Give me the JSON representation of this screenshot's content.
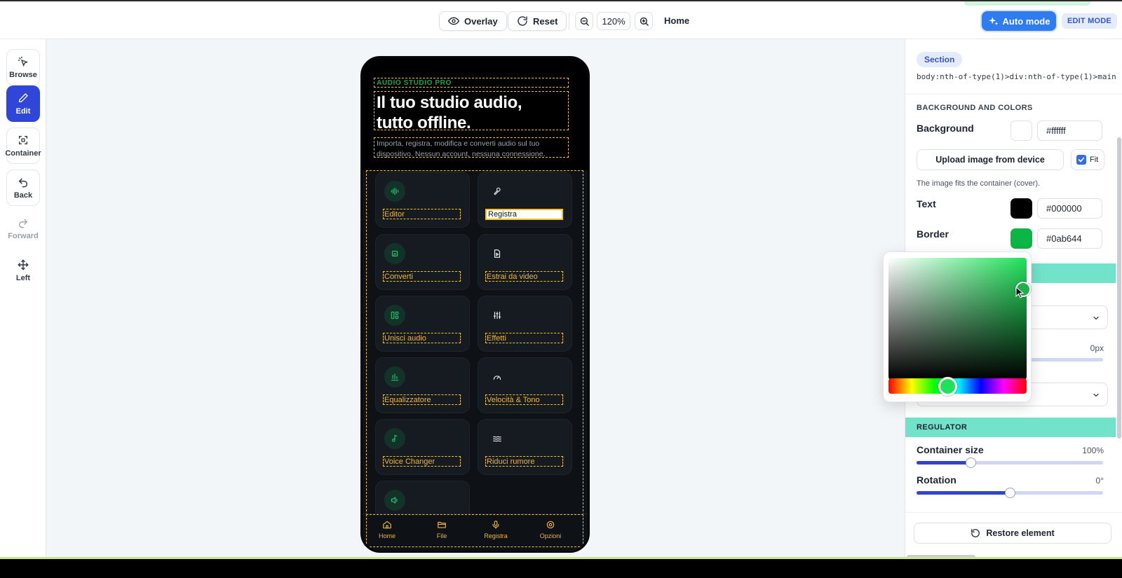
{
  "toolbar": {
    "overlay_label": "Overlay",
    "reset_label": "Reset",
    "zoom_level": "120%",
    "page_label": "Home",
    "auto_mode_label": "Auto mode",
    "edit_mode_badge": "EDIT MODE"
  },
  "sidebar": {
    "items": [
      {
        "label": "Browse",
        "icon": "pointer-sparkle-icon"
      },
      {
        "label": "Edit",
        "icon": "pencil-icon",
        "active": true
      },
      {
        "label": "Container",
        "icon": "container-icon"
      },
      {
        "label": "Back",
        "icon": "undo-icon"
      },
      {
        "label": "Forward",
        "icon": "redo-icon",
        "disabled": true
      },
      {
        "label": "Left",
        "icon": "move-icon"
      }
    ]
  },
  "phone": {
    "eyebrow": "AUDIO STUDIO PRO",
    "title_line1": "Il tuo studio audio,",
    "title_line2": "tutto offline.",
    "subtitle": "Importa, registra, modifica e converti audio sul tuo dispositivo. Nessun account, nessuna connessione.",
    "tiles": [
      {
        "label": "Editor",
        "icon": "waveform-icon",
        "style": "green"
      },
      {
        "label": "Registra",
        "icon": "microphone-icon",
        "style": "plain",
        "selected": true
      },
      {
        "label": "Converti",
        "icon": "convert-icon",
        "style": "green"
      },
      {
        "label": "Estrai da video",
        "icon": "file-video-icon",
        "style": "plain"
      },
      {
        "label": "Unisci audio",
        "icon": "merge-icon",
        "style": "green"
      },
      {
        "label": "Effetti",
        "icon": "sliders-icon",
        "style": "plain"
      },
      {
        "label": "Equalizzatore",
        "icon": "equalizer-icon",
        "style": "green"
      },
      {
        "label": "Velocità & Tono",
        "icon": "gauge-icon",
        "style": "plain"
      },
      {
        "label": "Voice Changer",
        "icon": "music-note-icon",
        "style": "green"
      },
      {
        "label": "Riduci rumore",
        "icon": "waves-icon",
        "style": "plain"
      },
      {
        "label": "",
        "icon": "speaker-icon",
        "style": "green"
      }
    ],
    "nav": [
      {
        "label": "Home",
        "icon": "home-icon"
      },
      {
        "label": "File",
        "icon": "folder-icon"
      },
      {
        "label": "Registra",
        "icon": "mic-icon"
      },
      {
        "label": "Opzioni",
        "icon": "settings-icon"
      }
    ]
  },
  "panel": {
    "section_chip": "Section",
    "selector": "body:nth-of-type(1)>div:nth-of-type(1)>main",
    "bg_heading": "BACKGROUND AND COLORS",
    "background_label": "Background",
    "background_hex": "#ffffff",
    "upload_label": "Upload image from device",
    "fit_label": "Fit",
    "fit_checked": true,
    "fit_help": "The image fits the container (cover).",
    "text_label": "Text",
    "text_hex": "#000000",
    "border_label": "Border",
    "border_hex": "#0ab644",
    "border_width_value": "0px",
    "regulator_heading": "REGULATOR",
    "container_size_label": "Container size",
    "container_size_value": "100%",
    "container_size_fraction": 0.29,
    "rotation_label": "Rotation",
    "rotation_value": "0°",
    "rotation_fraction": 0.5,
    "restore_label": "Restore element"
  },
  "colors": {
    "accent_blue": "#2f46d8",
    "phone_green": "#12a84a",
    "dashed_outline": "#f2c318",
    "teal_heading": "#72e3cb"
  }
}
